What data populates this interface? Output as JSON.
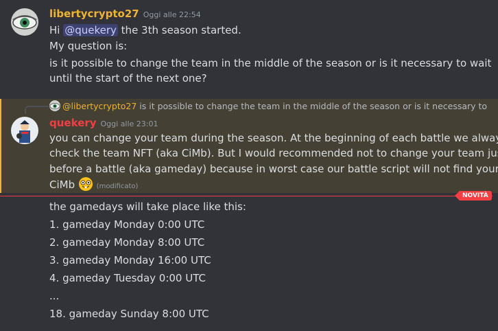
{
  "messages": [
    {
      "author": "libertycrypto27",
      "author_color": "#f0b232",
      "timestamp": "Oggi alle 22:54",
      "lines": {
        "l1_pre": "Hi ",
        "l1_mention": "@quekery",
        "l1_post": " the 3th season started.",
        "l2": "My question is:",
        "l3": "is it possible to change the team in the middle of the season or is it necessary to wait",
        "l4": "until the start of the next one?"
      }
    },
    {
      "reply": {
        "author": "@libertycrypto27",
        "text": "is it possible to change the team in the middle of the season or is it necessary to"
      },
      "author": "quekery",
      "author_color": "#f23f43",
      "timestamp": "Oggi alle 23:01",
      "lines": {
        "l1": "you can change your team during the season. At the beginning of each battle  we always",
        "l2": "check the team NFT (aka CiMb).  But I would recommended not to change your team just",
        "l3": "before a battle  (aka gameday) because in worst case our battle script will not find your",
        "l4": "CiMb"
      },
      "emoji": "nerd-face",
      "edited_label": "(modificato)"
    }
  ],
  "new_divider_label": "NOVITÀ",
  "followup": [
    "the gamedays will take place like this:",
    "1. gameday  Monday 0:00 UTC",
    "2. gameday Monday 8:00 UTC",
    "3. gameday Monday 16:00 UTC",
    "4. gameday Tuesday 0:00 UTC",
    "...",
    "18. gameday Sunday 8:00 UTC"
  ]
}
